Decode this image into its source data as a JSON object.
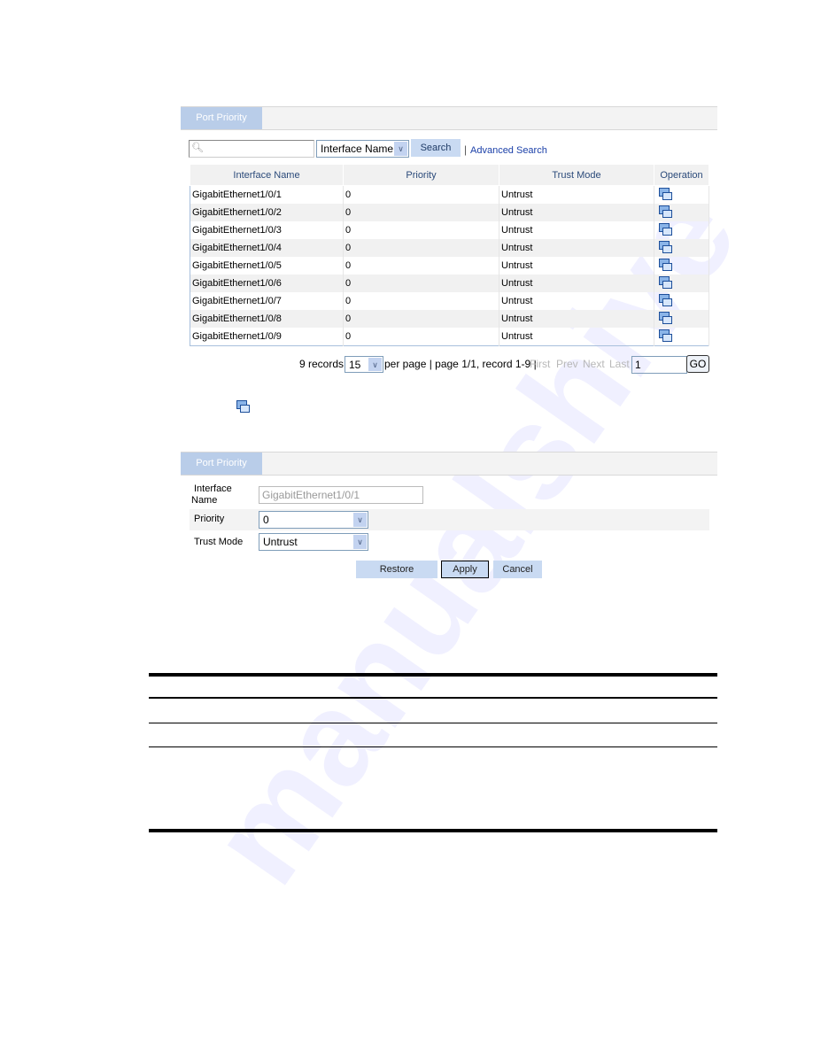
{
  "list_panel": {
    "tab_label": "Port Priority",
    "search": {
      "value": "",
      "field_select": "Interface Name",
      "search_label": "Search",
      "separator": "|",
      "advanced_label": "Advanced Search"
    },
    "columns": [
      "Interface Name",
      "Priority",
      "Trust Mode",
      "Operation"
    ],
    "rows": [
      {
        "interface": "GigabitEthernet1/0/1",
        "priority": "0",
        "trust": "Untrust",
        "op_icon": "edit-icon"
      },
      {
        "interface": "GigabitEthernet1/0/2",
        "priority": "0",
        "trust": "Untrust",
        "op_icon": "edit-icon"
      },
      {
        "interface": "GigabitEthernet1/0/3",
        "priority": "0",
        "trust": "Untrust",
        "op_icon": "edit-icon"
      },
      {
        "interface": "GigabitEthernet1/0/4",
        "priority": "0",
        "trust": "Untrust",
        "op_icon": "edit-icon"
      },
      {
        "interface": "GigabitEthernet1/0/5",
        "priority": "0",
        "trust": "Untrust",
        "op_icon": "edit-icon"
      },
      {
        "interface": "GigabitEthernet1/0/6",
        "priority": "0",
        "trust": "Untrust",
        "op_icon": "edit-icon"
      },
      {
        "interface": "GigabitEthernet1/0/7",
        "priority": "0",
        "trust": "Untrust",
        "op_icon": "edit-icon"
      },
      {
        "interface": "GigabitEthernet1/0/8",
        "priority": "0",
        "trust": "Untrust",
        "op_icon": "edit-icon"
      },
      {
        "interface": "GigabitEthernet1/0/9",
        "priority": "0",
        "trust": "Untrust",
        "op_icon": "edit-icon"
      }
    ],
    "pager": {
      "records": "9 records,",
      "per_page_value": "15",
      "info": "per page | page 1/1, record 1-9 |",
      "first": "First",
      "prev": "Prev",
      "next": "Next",
      "last": "Last",
      "page_input": "1",
      "go": "GO"
    }
  },
  "edit_panel": {
    "tab_label": "Port Priority",
    "interface_label_1": "Interface",
    "interface_label_2": "Name",
    "interface_value": "GigabitEthernet1/0/1",
    "priority_label": "Priority",
    "priority_value": "0",
    "trust_label": "Trust Mode",
    "trust_value": "Untrust",
    "restore": "Restore",
    "apply": "Apply",
    "cancel": "Cancel"
  },
  "colors": {
    "tab": "#b9cde9",
    "button": "#c9daf2",
    "link": "#1a3fa8"
  }
}
